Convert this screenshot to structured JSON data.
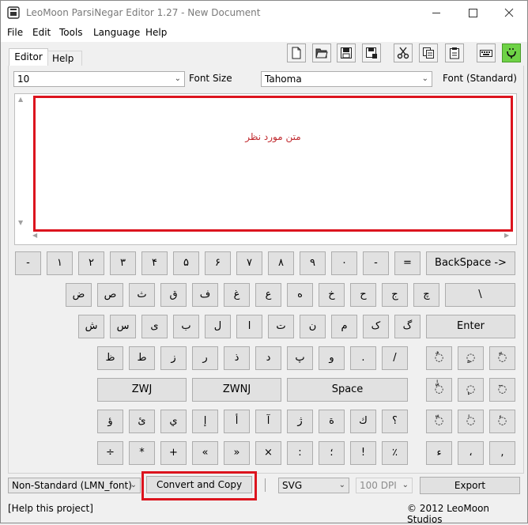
{
  "window": {
    "title": "LeoMoon ParsiNegar Editor 1.27 - New Document",
    "controls": [
      "–",
      "☐",
      "✕"
    ]
  },
  "menu": [
    "File",
    "Edit",
    "Tools",
    "Language",
    "Help"
  ],
  "tabs": [
    "Editor",
    "Help"
  ],
  "font_size": {
    "value": "10",
    "label": "Font Size"
  },
  "font_family": {
    "value": "Tahoma",
    "label": "Font (Standard)"
  },
  "editor": {
    "text": "متن مورد نظر"
  },
  "keyboard": {
    "row1": [
      "-",
      "١",
      "٢",
      "٣",
      "۴",
      "۵",
      "۶",
      "٧",
      "٨",
      "٩",
      "٠",
      "-",
      "="
    ],
    "backspace": "BackSpace ->",
    "row2": [
      "ض",
      "ص",
      "ث",
      "ق",
      "ف",
      "غ",
      "ع",
      "ه",
      "خ",
      "ح",
      "ج",
      "چ"
    ],
    "backslash": "\\",
    "row3": [
      "ش",
      "س",
      "ی",
      "ب",
      "ل",
      "ا",
      "ت",
      "ن",
      "م",
      "ک",
      "گ"
    ],
    "enter": "Enter",
    "row4": [
      "ظ",
      "ط",
      "ز",
      "ر",
      "ذ",
      "د",
      "پ",
      "و",
      ".",
      "/"
    ],
    "zwj": "ZWJ",
    "zwnj": "ZWNJ",
    "space": "Space",
    "row6": [
      "ؤ",
      "ئ",
      "ي",
      "إ",
      "أ",
      "آ",
      "ژ",
      "ة",
      "ك",
      "؟"
    ],
    "row7": [
      "÷",
      "*",
      "+",
      "«",
      "»",
      "×",
      ":",
      "؛",
      "!",
      "٪"
    ],
    "diacritics": [
      "◌ٌ",
      "◌ٍ",
      "◌ً",
      "◌ّٰ",
      "◌ٕ",
      "◌ٓ",
      "◌ّ",
      "◌ٰ",
      "◌ٔ",
      "ء",
      "،",
      ","
    ]
  },
  "bottom": {
    "mode": "Non-Standard (LMN_font)",
    "convert": "Convert and Copy",
    "format": "SVG",
    "dpi": "100 DPI",
    "export": "Export"
  },
  "status": {
    "help_link": "[Help this project]",
    "copyright": "© 2012 LeoMoon Studios"
  },
  "colors": {
    "highlight": "#dc141e",
    "editor_text": "#c0282d"
  }
}
